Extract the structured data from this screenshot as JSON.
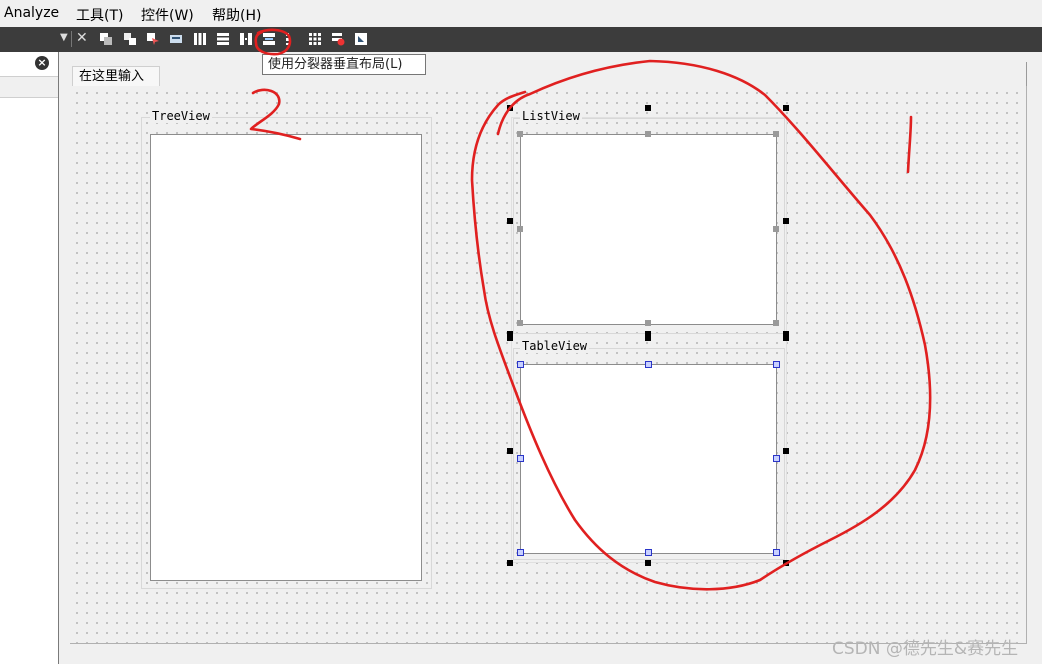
{
  "menu": {
    "items": [
      "Analyze",
      "工具(T)",
      "控件(W)",
      "帮助(H)"
    ]
  },
  "toolbar": {
    "icons": [
      "close-icon",
      "layout-icon",
      "send-to-back-icon",
      "bring-to-front-icon",
      "buddy-icon",
      "horizontal-layout-icon",
      "vertical-layout-icon",
      "horizontal-splitter-icon",
      "vertical-splitter-icon",
      "form-layout-icon",
      "grid-layout-icon",
      "break-layout-icon",
      "adjust-size-icon"
    ],
    "tooltip": "使用分裂器垂直布局(L)"
  },
  "editor": {
    "tab_label": "在这里输入"
  },
  "widgets": {
    "tree_title": "TreeView",
    "list_title": "ListView",
    "table_title": "TableView"
  },
  "annotations": {
    "colors": {
      "ink": "#e02020"
    }
  },
  "watermark": "CSDN @德先生&赛先生"
}
